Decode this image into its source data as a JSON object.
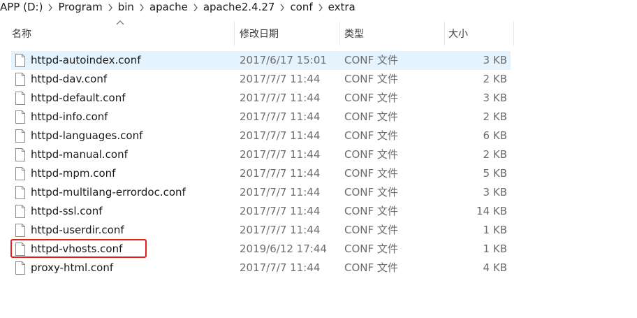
{
  "breadcrumb": {
    "items": [
      "APP (D:)",
      "Program",
      "bin",
      "apache",
      "apache2.4.27",
      "conf",
      "extra"
    ]
  },
  "columns": {
    "name": "名称",
    "date": "修改日期",
    "type": "类型",
    "size": "大小"
  },
  "files": [
    {
      "name": "httpd-autoindex.conf",
      "date": "2017/6/17 15:01",
      "type": "CONF 文件",
      "size": "3 KB",
      "selected": true
    },
    {
      "name": "httpd-dav.conf",
      "date": "2017/7/7 11:44",
      "type": "CONF 文件",
      "size": "2 KB"
    },
    {
      "name": "httpd-default.conf",
      "date": "2017/7/7 11:44",
      "type": "CONF 文件",
      "size": "3 KB"
    },
    {
      "name": "httpd-info.conf",
      "date": "2017/7/7 11:44",
      "type": "CONF 文件",
      "size": "2 KB"
    },
    {
      "name": "httpd-languages.conf",
      "date": "2017/7/7 11:44",
      "type": "CONF 文件",
      "size": "6 KB"
    },
    {
      "name": "httpd-manual.conf",
      "date": "2017/7/7 11:44",
      "type": "CONF 文件",
      "size": "2 KB"
    },
    {
      "name": "httpd-mpm.conf",
      "date": "2017/7/7 11:44",
      "type": "CONF 文件",
      "size": "5 KB"
    },
    {
      "name": "httpd-multilang-errordoc.conf",
      "date": "2017/7/7 11:44",
      "type": "CONF 文件",
      "size": "3 KB"
    },
    {
      "name": "httpd-ssl.conf",
      "date": "2017/7/7 11:44",
      "type": "CONF 文件",
      "size": "14 KB"
    },
    {
      "name": "httpd-userdir.conf",
      "date": "2017/7/7 11:44",
      "type": "CONF 文件",
      "size": "1 KB"
    },
    {
      "name": "httpd-vhosts.conf",
      "date": "2019/6/12 17:44",
      "type": "CONF 文件",
      "size": "1 KB",
      "highlighted": true
    },
    {
      "name": "proxy-html.conf",
      "date": "2017/7/7 11:44",
      "type": "CONF 文件",
      "size": "4 KB"
    }
  ],
  "colors": {
    "selection": "#e5f3ff",
    "highlight_box": "#e0201a"
  },
  "icons": {
    "file": "file-icon",
    "separator": "chevron-right-icon",
    "sort": "sort-ascending-icon"
  }
}
